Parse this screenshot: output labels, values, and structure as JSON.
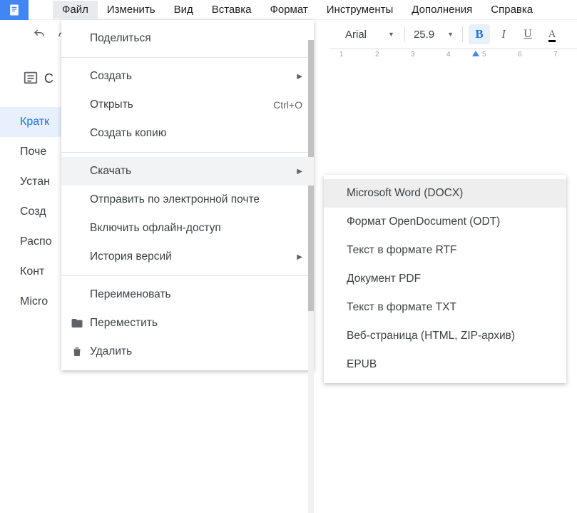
{
  "menubar": {
    "items": [
      {
        "label": "Файл"
      },
      {
        "label": "Изменить"
      },
      {
        "label": "Вид"
      },
      {
        "label": "Вставка"
      },
      {
        "label": "Формат"
      },
      {
        "label": "Инструменты"
      },
      {
        "label": "Дополнения"
      },
      {
        "label": "Справка"
      }
    ]
  },
  "toolbar": {
    "font_name": "Arial",
    "font_size": "25.9",
    "bold": "B",
    "italic": "I",
    "underline": "U",
    "colorA": "A"
  },
  "ruler": {
    "marks": [
      "1",
      "2",
      "3",
      "4",
      "5",
      "6",
      "7"
    ]
  },
  "outline": {
    "letter": "С",
    "items": [
      {
        "label": "Кратк"
      },
      {
        "label": "Поче"
      },
      {
        "label": "Устан"
      },
      {
        "label": "Созд"
      },
      {
        "label": "Распо"
      },
      {
        "label": "Конт"
      },
      {
        "label": "Micro"
      }
    ]
  },
  "file_menu": {
    "share": "Поделиться",
    "new": "Создать",
    "open": "Открыть",
    "open_shortcut": "Ctrl+O",
    "copy": "Создать копию",
    "download": "Скачать",
    "email": "Отправить по электронной почте",
    "offline": "Включить офлайн-доступ",
    "history": "История версий",
    "rename": "Переименовать",
    "move": "Переместить",
    "delete": "Удалить"
  },
  "download_sub": {
    "items": [
      {
        "label": "Microsoft Word (DOCX)"
      },
      {
        "label": "Формат OpenDocument (ODT)"
      },
      {
        "label": "Текст в формате RTF"
      },
      {
        "label": "Документ PDF"
      },
      {
        "label": "Текст в формате TXT"
      },
      {
        "label": "Веб-страница (HTML, ZIP-архив)"
      },
      {
        "label": "EPUB"
      }
    ]
  }
}
